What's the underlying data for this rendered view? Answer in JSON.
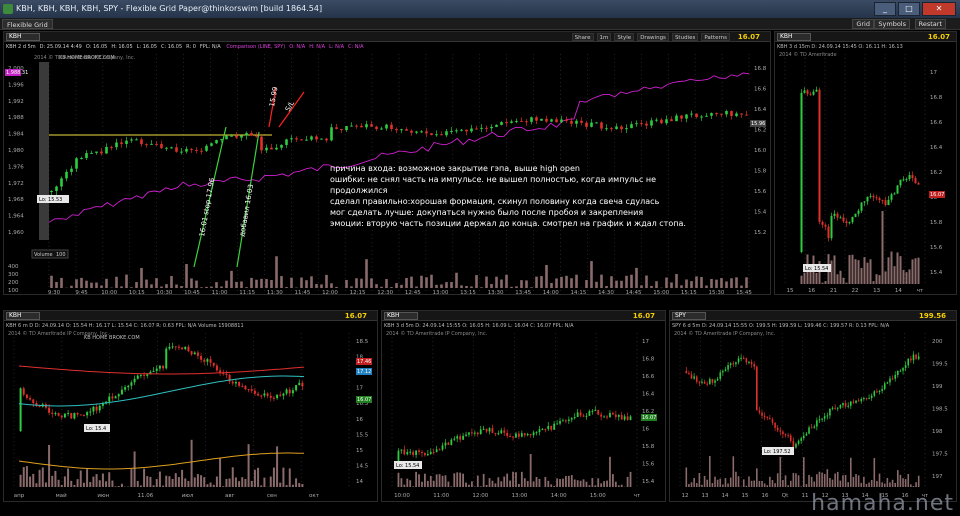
{
  "window": {
    "title": "KBH, KBH, KBH, KBH, SPY - Flexible Grid Paper@thinkorswim [build 1864.54]",
    "minimize": "_",
    "maximize": "□",
    "close": "✕"
  },
  "menubar": {
    "tab": "Flexible Grid",
    "buttons": [
      "Grid",
      "Symbols",
      "Restart"
    ]
  },
  "main_chart": {
    "symbol": "KBH",
    "share": "Share",
    "interval": "1m",
    "style": "Style",
    "drawings": "Drawings",
    "studies": "Studies",
    "patterns": "Patterns",
    "price": "16.07",
    "info": [
      "KBH 2 d 5m",
      "D: 25.09.14 4:49",
      "O: 16.05",
      "H: 16.05",
      "L: 16.05",
      "C: 16.05",
      "R: 0",
      "FPL: N/A"
    ],
    "comparison": "Comparison (LINE, SPY)",
    "comparison_vals": [
      "O: N/A",
      "H: N/A",
      "L: N/A",
      "C: N/A"
    ],
    "broker": "2014 © TD Ameritrade IP Company, Inc.",
    "company": "KB HOME BROKE.COM",
    "low_label": "Lo: 15.53",
    "left_price_label": "1,988.31",
    "right_price_label": "15.96",
    "left_axis": [
      "2,000",
      "1,996",
      "1,992",
      "1,988",
      "1,984",
      "1,980",
      "1,976",
      "1,972",
      "1,968",
      "1,964",
      "1,960"
    ],
    "right_axis": [
      "16.8",
      "16.6",
      "16.4",
      "16.2",
      "16.0",
      "15.8",
      "15.6",
      "15.4",
      "15.2"
    ],
    "volume_label": "Volume",
    "volume_val": "100",
    "volume_axis": [
      "400",
      "300",
      "200",
      "100"
    ],
    "time_axis": [
      "9:30",
      "9:45",
      "10:00",
      "10:15",
      "10:30",
      "10:45",
      "11:00",
      "11:15",
      "11:30",
      "11:45",
      "12:00",
      "12:15",
      "12:30",
      "12:45",
      "13:00",
      "13:15",
      "13:30",
      "13:45",
      "14:00",
      "14:15",
      "14:30",
      "14:45",
      "15:00",
      "15:15",
      "15:30",
      "15:45"
    ],
    "annotations": {
      "stop": "16.01 stop 17.96",
      "add": "добавил 16.03",
      "target": "15.99",
      "sl": "S/L"
    }
  },
  "note": {
    "lines": [
      "причина входа: возможное закрытие гэпа, выше high open",
      "ошибки: не снял часть на импульсе. не вышел полностью, когда импульс не",
      "продолжился",
      "сделал правильно:хорошая формация, скинул половину когда свеча сдулась",
      "мог сделать лучше: докупаться нужно было после пробоя и закрепления",
      "эмоции: вторую часть позиции держал до конца. смотрел на график и ждал стопа."
    ]
  },
  "top_right_chart": {
    "symbol": "KBH",
    "price": "16.07",
    "info": "KBH 3 d 15m  D: 24.09.14 15:45  O: 16.11  H: 16.13",
    "broker": "2014 © TD Ameritrade",
    "low_label": "Lo: 15.54",
    "price_tag": "16.07",
    "right_axis": [
      "17",
      "16.8",
      "16.6",
      "16.4",
      "16.2",
      "16",
      "15.8",
      "15.6",
      "15.4"
    ],
    "time_axis": [
      "15",
      "16",
      "21",
      "22",
      "13",
      "14",
      "чт"
    ]
  },
  "bottom_left_chart": {
    "symbol": "KBH",
    "price": "16.07",
    "info": "KBH 6 m D  D: 24.09.14  O: 15.54  H: 16.17  L: 15.54  C: 16.07  R: 0.63  FPL: N/A  Volume  15908811",
    "broker": "2014 © TD Ameritrade IP Company, Inc.",
    "company": "KB HOME BROKE.COM",
    "low_label": "Lo: 15.4",
    "price_tags": [
      "17.46",
      "17.12",
      "16.07"
    ],
    "right_axis": [
      "18.5",
      "18",
      "17.5",
      "17",
      "16.5",
      "16",
      "15.5",
      "15",
      "14.5",
      "14"
    ],
    "time_axis": [
      "апр",
      "май",
      "июн",
      "11.06",
      "июл",
      "авг",
      "сен",
      "окт"
    ]
  },
  "bottom_mid_chart": {
    "symbol": "KBH",
    "price": "16.07",
    "info": "KBH 3 d 5m  D: 24.09.14 15:55  O: 16.05  H: 16.09  L: 16.04  C: 16.07  FPL: N/A",
    "broker": "2014 © TD Ameritrade IP Company, Inc.",
    "low_label": "Lo: 15.54",
    "price_tag": "16.07",
    "right_axis": [
      "17",
      "16.8",
      "16.6",
      "16.4",
      "16.2",
      "16",
      "15.8",
      "15.6",
      "15.4"
    ],
    "time_axis": [
      "10:00",
      "11:00",
      "12:00",
      "13:00",
      "14:00",
      "15:00",
      "чт"
    ]
  },
  "bottom_right_chart": {
    "symbol": "SPY",
    "price": "199.56",
    "info": "SPY 6 d 5m  D: 24.09.14 15:55  O: 199.5  H: 199.59  L: 199.46  C: 199.57  R: 0.13  FPL: N/A",
    "broker": "2014 © TD Ameritrade IP Company, Inc.",
    "low_label": "Lo: 197.52",
    "right_axis": [
      "200",
      "199.5",
      "199",
      "198.5",
      "198",
      "197.5",
      "197"
    ],
    "time_axis": [
      "12",
      "13",
      "14",
      "15",
      "16",
      "Qt",
      "11",
      "12",
      "13",
      "14",
      "15",
      "16",
      "чт"
    ]
  },
  "watermark": "hamaha.net",
  "colors": {
    "up": "#2ecc40",
    "down": "#e0302a",
    "comparison": "#d020d0",
    "level": "#f0e040",
    "price": "#f5d000",
    "volume": "#8a6a6a",
    "arrow_green": "#3cd23c",
    "arrow_red": "#ff2020"
  }
}
